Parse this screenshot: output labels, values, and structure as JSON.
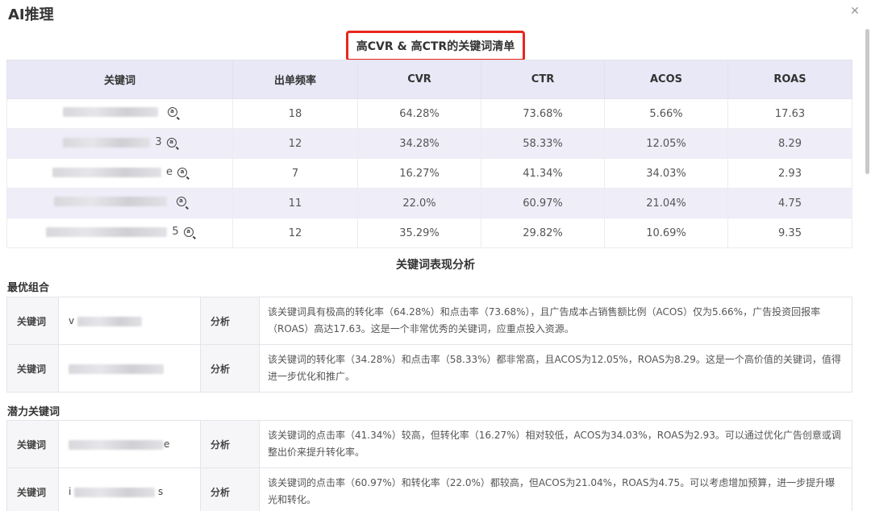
{
  "dialog": {
    "title": "AI推理",
    "close_icon": "close-icon"
  },
  "section1": {
    "title": "高CVR & 高CTR的关键词清单"
  },
  "keyword_table": {
    "headers": [
      "关键词",
      "出单频率",
      "CVR",
      "CTR",
      "ACOS",
      "ROAS"
    ],
    "rows": [
      {
        "keyword_visible": "",
        "freq": "18",
        "cvr": "64.28%",
        "ctr": "73.68%",
        "acos": "5.66%",
        "roas": "17.63"
      },
      {
        "keyword_visible": "3",
        "freq": "12",
        "cvr": "34.28%",
        "ctr": "58.33%",
        "acos": "12.05%",
        "roas": "8.29"
      },
      {
        "keyword_visible": "e",
        "freq": "7",
        "cvr": "16.27%",
        "ctr": "41.34%",
        "acos": "34.03%",
        "roas": "2.93"
      },
      {
        "keyword_visible": "",
        "freq": "11",
        "cvr": "22.0%",
        "ctr": "60.97%",
        "acos": "21.04%",
        "roas": "4.75"
      },
      {
        "keyword_visible": "5",
        "freq": "12",
        "cvr": "35.29%",
        "ctr": "29.82%",
        "acos": "10.69%",
        "roas": "9.35"
      }
    ]
  },
  "section2": {
    "title": "关键词表现分析"
  },
  "groups": [
    {
      "label": "最优组合",
      "items": [
        {
          "kw_label": "关键词",
          "kw_prefix": "v",
          "kw_suffix": "",
          "analysis_label": "分析",
          "analysis": "该关键词具有极高的转化率（64.28%）和点击率（73.68%），且广告成本占销售额比例（ACOS）仅为5.66%，广告投资回报率（ROAS）高达17.63。这是一个非常优秀的关键词，应重点投入资源。"
        },
        {
          "kw_label": "关键词",
          "kw_prefix": "",
          "kw_suffix": "",
          "analysis_label": "分析",
          "analysis": "该关键词的转化率（34.28%）和点击率（58.33%）都非常高，且ACOS为12.05%，ROAS为8.29。这是一个高价值的关键词，值得进一步优化和推广。"
        }
      ]
    },
    {
      "label": "潜力关键词",
      "items": [
        {
          "kw_label": "关键词",
          "kw_prefix": "",
          "kw_suffix": "e",
          "analysis_label": "分析",
          "analysis": "该关键词的点击率（41.34%）较高，但转化率（16.27%）相对较低，ACOS为34.03%，ROAS为2.93。可以通过优化广告创意或调整出价来提升转化率。"
        },
        {
          "kw_label": "关键词",
          "kw_prefix": "i",
          "kw_suffix": "s",
          "analysis_label": "分析",
          "analysis": "该关键词的点击率（60.97%）和转化率（22.0%）都较高，但ACOS为21.04%，ROAS为4.75。可以考虑增加预算，进一步提升曝光和转化。"
        }
      ]
    }
  ],
  "colors": {
    "header_bg": "#e9e8f6",
    "alt_row_bg": "#eeedf8",
    "highlight_border": "#e8271d"
  }
}
